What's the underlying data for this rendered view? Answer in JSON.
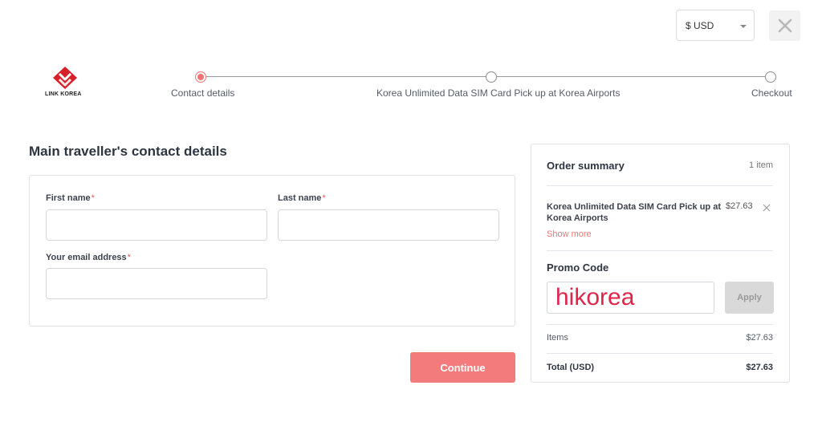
{
  "header": {
    "currency": "$ USD",
    "close_icon": "close-icon"
  },
  "brand": {
    "logo_text": "LINK KOREA",
    "logo_color": "#d6202a"
  },
  "steps": [
    {
      "label": "Contact details",
      "active": true
    },
    {
      "label": "Korea Unlimited Data SIM Card Pick up at Korea Airports",
      "active": false
    },
    {
      "label": "Checkout",
      "active": false
    }
  ],
  "form": {
    "title": "Main traveller's contact details",
    "first_name_label": "First name",
    "last_name_label": "Last name",
    "email_label": "Your email address",
    "required_mark": "*",
    "first_name_value": "",
    "last_name_value": "",
    "email_value": ""
  },
  "continue_label": "Continue",
  "summary": {
    "title": "Order summary",
    "count": "1 item",
    "item_name": "Korea Unlimited Data SIM Card Pick up at Korea Airports",
    "item_price": "$27.63",
    "show_more": "Show more",
    "promo_title": "Promo Code",
    "promo_value": "hikorea",
    "apply_label": "Apply",
    "items_label": "Items",
    "items_value": "$27.63",
    "total_label": "Total (USD)",
    "total_value": "$27.63"
  },
  "colors": {
    "accent": "#f47b7b",
    "promo_text": "#e0244a"
  }
}
